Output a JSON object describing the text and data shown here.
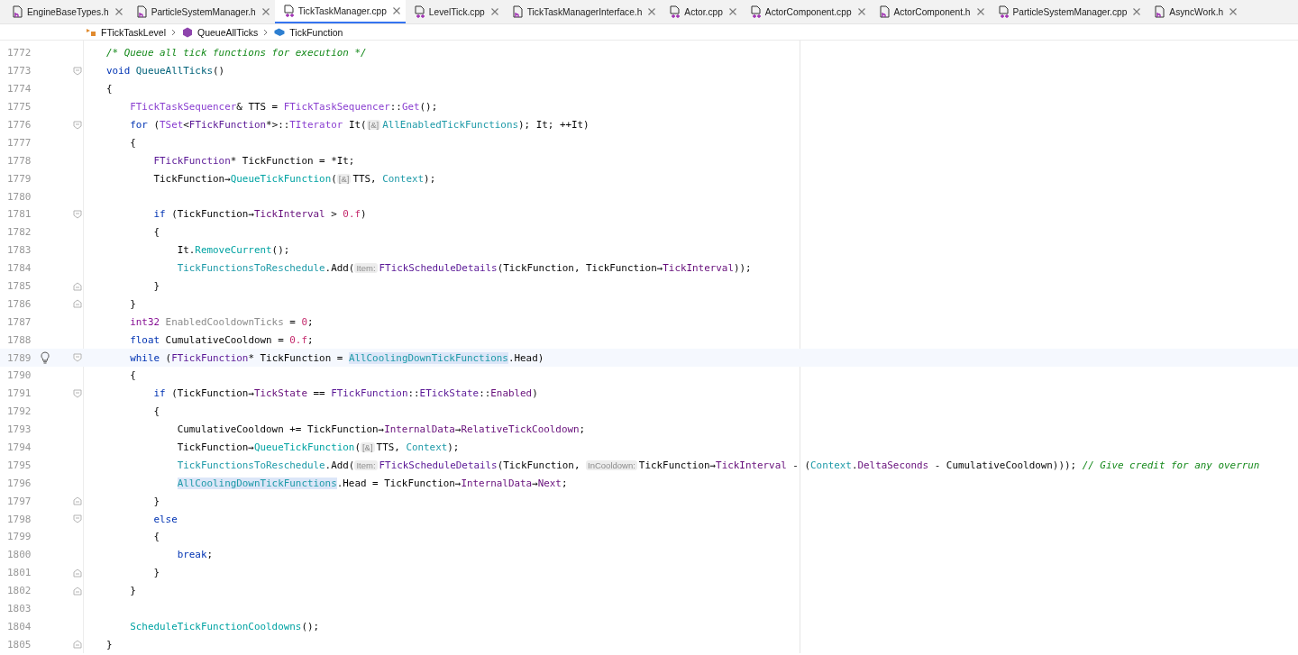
{
  "tabs": [
    {
      "label": "EngineBaseTypes.h",
      "kind": "h",
      "selected": false
    },
    {
      "label": "ParticleSystemManager.h",
      "kind": "h",
      "selected": false
    },
    {
      "label": "TickTaskManager.cpp",
      "kind": "cpp",
      "selected": true
    },
    {
      "label": "LevelTick.cpp",
      "kind": "cpp",
      "selected": false
    },
    {
      "label": "TickTaskManagerInterface.h",
      "kind": "h",
      "selected": false
    },
    {
      "label": "Actor.cpp",
      "kind": "cpp",
      "selected": false
    },
    {
      "label": "ActorComponent.cpp",
      "kind": "cpp",
      "selected": false
    },
    {
      "label": "ActorComponent.h",
      "kind": "h",
      "selected": false
    },
    {
      "label": "ParticleSystemManager.cpp",
      "kind": "cpp",
      "selected": false
    },
    {
      "label": "AsyncWork.h",
      "kind": "h",
      "selected": false
    }
  ],
  "breadcrumbs": [
    {
      "label": "FTickTaskLevel",
      "kind": "class"
    },
    {
      "label": "QueueAllTicks",
      "kind": "method"
    },
    {
      "label": "TickFunction",
      "kind": "variable"
    }
  ],
  "lines": [
    {
      "number": "1772",
      "fold_start": false,
      "fold_end": false,
      "current": false,
      "code": [
        {
          "text": "/* Queue all tick functions for execution */",
          "kind": "comment"
        }
      ]
    },
    {
      "number": "1773",
      "fold_start": true,
      "fold_end": false,
      "current": false,
      "code": [
        {
          "text": "void",
          "kind": "keyword"
        },
        {
          "text": " QueueAllTicks",
          "kind": "decl"
        },
        {
          "text": "()",
          "kind": "plain"
        }
      ]
    },
    {
      "number": "1774",
      "fold_start": false,
      "fold_end": false,
      "current": false,
      "code": [
        {
          "text": "{",
          "kind": "plain"
        }
      ]
    },
    {
      "number": "1775",
      "fold_start": false,
      "fold_end": false,
      "current": false,
      "code": [
        {
          "text": "    FTickTaskSequencer",
          "kind": "type"
        },
        {
          "text": "& TTS = ",
          "kind": "plain"
        },
        {
          "text": "FTickTaskSequencer",
          "kind": "type"
        },
        {
          "text": "::",
          "kind": "plain"
        },
        {
          "text": "Get",
          "kind": "type"
        },
        {
          "text": "();",
          "kind": "plain"
        }
      ]
    },
    {
      "number": "1776",
      "fold_start": true,
      "fold_end": false,
      "current": false,
      "code": [
        {
          "text": "    for",
          "kind": "keyword"
        },
        {
          "text": " (",
          "kind": "plain"
        },
        {
          "text": "TSet",
          "kind": "type"
        },
        {
          "text": "<",
          "kind": "plain"
        },
        {
          "text": "FTickFunction",
          "kind": "class"
        },
        {
          "text": "*>::",
          "kind": "plain"
        },
        {
          "text": "TIterator",
          "kind": "type"
        },
        {
          "text": " It(",
          "kind": "plain"
        },
        {
          "text": "[&]",
          "kind": "hint"
        },
        {
          "text": "AllEnabledTickFunctions",
          "kind": "global"
        },
        {
          "text": "); It; ++It)",
          "kind": "plain"
        }
      ]
    },
    {
      "number": "1777",
      "fold_start": false,
      "fold_end": false,
      "current": false,
      "code": [
        {
          "text": "    {",
          "kind": "plain"
        }
      ]
    },
    {
      "number": "1778",
      "fold_start": false,
      "fold_end": false,
      "current": false,
      "code": [
        {
          "text": "        FTickFunction",
          "kind": "class"
        },
        {
          "text": "* TickFunction = *It;",
          "kind": "plain"
        }
      ]
    },
    {
      "number": "1779",
      "fold_start": false,
      "fold_end": false,
      "current": false,
      "code": [
        {
          "text": "        TickFunction→",
          "kind": "plain"
        },
        {
          "text": "QueueTickFunction",
          "kind": "call"
        },
        {
          "text": "(",
          "kind": "plain"
        },
        {
          "text": "[&]",
          "kind": "hint"
        },
        {
          "text": "TTS, ",
          "kind": "plain"
        },
        {
          "text": "Context",
          "kind": "global"
        },
        {
          "text": ");",
          "kind": "plain"
        }
      ]
    },
    {
      "number": "1780",
      "fold_start": false,
      "fold_end": false,
      "current": false
    },
    {
      "number": "1781",
      "fold_start": true,
      "fold_end": false,
      "current": false,
      "code": [
        {
          "text": "        if",
          "kind": "keyword"
        },
        {
          "text": " (TickFunction→",
          "kind": "plain"
        },
        {
          "text": "TickInterval",
          "kind": "member"
        },
        {
          "text": " > ",
          "kind": "plain"
        },
        {
          "text": "0.f",
          "kind": "number"
        },
        {
          "text": ")",
          "kind": "plain"
        }
      ]
    },
    {
      "number": "1782",
      "fold_start": false,
      "fold_end": false,
      "current": false,
      "code": [
        {
          "text": "        {",
          "kind": "plain"
        }
      ]
    },
    {
      "number": "1783",
      "fold_start": false,
      "fold_end": false,
      "current": false,
      "code": [
        {
          "text": "            It.",
          "kind": "plain"
        },
        {
          "text": "RemoveCurrent",
          "kind": "call"
        },
        {
          "text": "();",
          "kind": "plain"
        }
      ]
    },
    {
      "number": "1784",
      "fold_start": false,
      "fold_end": false,
      "current": false,
      "code": [
        {
          "text": "            TickFunctionsToReschedule",
          "kind": "global"
        },
        {
          "text": ".Add(",
          "kind": "plain"
        },
        {
          "text": "Item:",
          "kind": "hint"
        },
        {
          "text": "FTickScheduleDetails",
          "kind": "class"
        },
        {
          "text": "(TickFunction, TickFunction→",
          "kind": "plain"
        },
        {
          "text": "TickInterval",
          "kind": "member"
        },
        {
          "text": "));",
          "kind": "plain"
        }
      ]
    },
    {
      "number": "1785",
      "fold_start": false,
      "fold_end": true,
      "current": false,
      "code": [
        {
          "text": "        }",
          "kind": "plain"
        }
      ]
    },
    {
      "number": "1786",
      "fold_start": false,
      "fold_end": true,
      "current": false,
      "code": [
        {
          "text": "    }",
          "kind": "plain"
        }
      ]
    },
    {
      "number": "1787",
      "fold_start": false,
      "fold_end": false,
      "current": false,
      "code": [
        {
          "text": "    int32",
          "kind": "typekw"
        },
        {
          "text": " EnabledCooldownTicks",
          "kind": "unused"
        },
        {
          "text": " = ",
          "kind": "plain"
        },
        {
          "text": "0",
          "kind": "number"
        },
        {
          "text": ";",
          "kind": "plain"
        }
      ]
    },
    {
      "number": "1788",
      "fold_start": false,
      "fold_end": false,
      "current": false,
      "code": [
        {
          "text": "    float",
          "kind": "keyword"
        },
        {
          "text": " CumulativeCooldown = ",
          "kind": "plain"
        },
        {
          "text": "0.f",
          "kind": "number"
        },
        {
          "text": ";",
          "kind": "plain"
        }
      ]
    },
    {
      "number": "1789",
      "fold_start": true,
      "fold_end": false,
      "current": true,
      "code": [
        {
          "text": "    while",
          "kind": "keyword"
        },
        {
          "text": " (",
          "kind": "plain"
        },
        {
          "text": "FTickFunction",
          "kind": "class"
        },
        {
          "text": "* TickFunction = ",
          "kind": "plain"
        },
        {
          "text": "AllCoolingDownTickFunctions",
          "kind": "highlight"
        },
        {
          "text": ".Head)",
          "kind": "plain"
        }
      ]
    },
    {
      "number": "1790",
      "fold_start": false,
      "fold_end": false,
      "current": false,
      "code": [
        {
          "text": "    {",
          "kind": "plain"
        }
      ]
    },
    {
      "number": "1791",
      "fold_start": true,
      "fold_end": false,
      "current": false,
      "code": [
        {
          "text": "        if",
          "kind": "keyword"
        },
        {
          "text": " (TickFunction→",
          "kind": "plain"
        },
        {
          "text": "TickState",
          "kind": "member"
        },
        {
          "text": " == ",
          "kind": "plain"
        },
        {
          "text": "FTickFunction",
          "kind": "class"
        },
        {
          "text": "::",
          "kind": "plain"
        },
        {
          "text": "ETickState",
          "kind": "class"
        },
        {
          "text": "::",
          "kind": "plain"
        },
        {
          "text": "Enabled",
          "kind": "member"
        },
        {
          "text": ")",
          "kind": "plain"
        }
      ]
    },
    {
      "number": "1792",
      "fold_start": false,
      "fold_end": false,
      "current": false,
      "code": [
        {
          "text": "        {",
          "kind": "plain"
        }
      ]
    },
    {
      "number": "1793",
      "fold_start": false,
      "fold_end": false,
      "current": false,
      "code": [
        {
          "text": "            CumulativeCooldown += TickFunction→",
          "kind": "plain"
        },
        {
          "text": "InternalData",
          "kind": "member"
        },
        {
          "text": "→",
          "kind": "plain"
        },
        {
          "text": "RelativeTickCooldown",
          "kind": "member"
        },
        {
          "text": ";",
          "kind": "plain"
        }
      ]
    },
    {
      "number": "1794",
      "fold_start": false,
      "fold_end": false,
      "current": false,
      "code": [
        {
          "text": "            TickFunction→",
          "kind": "plain"
        },
        {
          "text": "QueueTickFunction",
          "kind": "call"
        },
        {
          "text": "(",
          "kind": "plain"
        },
        {
          "text": "[&]",
          "kind": "hint"
        },
        {
          "text": "TTS, ",
          "kind": "plain"
        },
        {
          "text": "Context",
          "kind": "global"
        },
        {
          "text": ");",
          "kind": "plain"
        }
      ]
    },
    {
      "number": "1795",
      "fold_start": false,
      "fold_end": false,
      "current": false,
      "code": [
        {
          "text": "            TickFunctionsToReschedule",
          "kind": "global"
        },
        {
          "text": ".Add(",
          "kind": "plain"
        },
        {
          "text": "Item:",
          "kind": "hint"
        },
        {
          "text": "FTickScheduleDetails",
          "kind": "class"
        },
        {
          "text": "(TickFunction, ",
          "kind": "plain"
        },
        {
          "text": "InCooldown:",
          "kind": "hint"
        },
        {
          "text": "TickFunction→",
          "kind": "plain"
        },
        {
          "text": "TickInterval",
          "kind": "member"
        },
        {
          "text": " - (",
          "kind": "plain"
        },
        {
          "text": "Context",
          "kind": "global"
        },
        {
          "text": ".",
          "kind": "plain"
        },
        {
          "text": "DeltaSeconds",
          "kind": "member"
        },
        {
          "text": " - CumulativeCooldown))); ",
          "kind": "plain"
        },
        {
          "text": "// Give credit for any overrun",
          "kind": "comment"
        }
      ]
    },
    {
      "number": "1796",
      "fold_start": false,
      "fold_end": false,
      "current": false,
      "code": [
        {
          "text": "            AllCoolingDownTickFunctions",
          "kind": "highlight"
        },
        {
          "text": ".Head = TickFunction→",
          "kind": "plain"
        },
        {
          "text": "InternalData",
          "kind": "member"
        },
        {
          "text": "→",
          "kind": "plain"
        },
        {
          "text": "Next",
          "kind": "member"
        },
        {
          "text": ";",
          "kind": "plain"
        }
      ]
    },
    {
      "number": "1797",
      "fold_start": false,
      "fold_end": true,
      "current": false,
      "code": [
        {
          "text": "        }",
          "kind": "plain"
        }
      ]
    },
    {
      "number": "1798",
      "fold_start": true,
      "fold_end": false,
      "current": false,
      "code": [
        {
          "text": "        else",
          "kind": "keyword"
        }
      ]
    },
    {
      "number": "1799",
      "fold_start": false,
      "fold_end": false,
      "current": false,
      "code": [
        {
          "text": "        {",
          "kind": "plain"
        }
      ]
    },
    {
      "number": "1800",
      "fold_start": false,
      "fold_end": false,
      "current": false,
      "code": [
        {
          "text": "            break",
          "kind": "keyword"
        },
        {
          "text": ";",
          "kind": "plain"
        }
      ]
    },
    {
      "number": "1801",
      "fold_start": false,
      "fold_end": true,
      "current": false,
      "code": [
        {
          "text": "        }",
          "kind": "plain"
        }
      ]
    },
    {
      "number": "1802",
      "fold_start": false,
      "fold_end": true,
      "current": false,
      "code": [
        {
          "text": "    }",
          "kind": "plain"
        }
      ]
    },
    {
      "number": "1803",
      "fold_start": false,
      "fold_end": false,
      "current": false
    },
    {
      "number": "1804",
      "fold_start": false,
      "fold_end": false,
      "current": false,
      "code": [
        {
          "text": "    ScheduleTickFunctionCooldowns",
          "kind": "call"
        },
        {
          "text": "();",
          "kind": "plain"
        }
      ]
    },
    {
      "number": "1805",
      "fold_start": false,
      "fold_end": true,
      "current": false,
      "code": [
        {
          "text": "}",
          "kind": "plain"
        }
      ]
    }
  ]
}
